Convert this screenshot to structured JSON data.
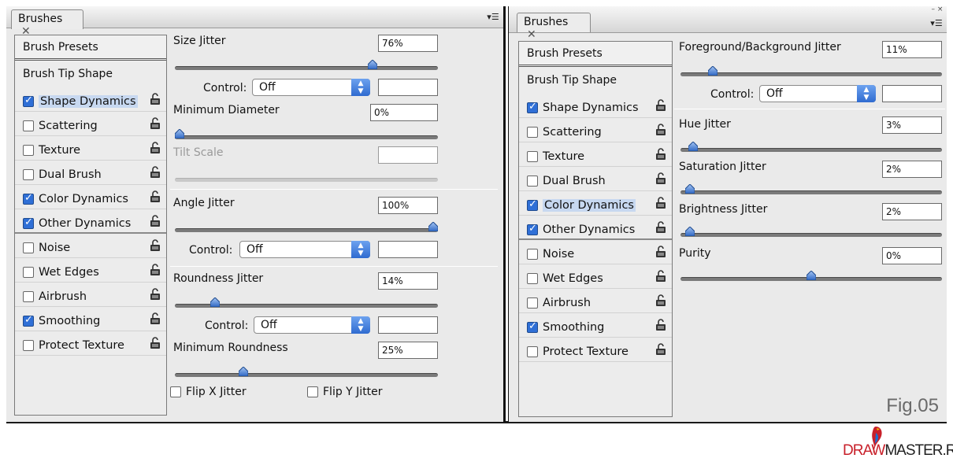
{
  "left_panel": {
    "tab_label": "Brushes",
    "sidebar": {
      "presets": "Brush Presets",
      "tip_shape": "Brush Tip Shape",
      "items": [
        {
          "label": "Shape Dynamics",
          "checked": true
        },
        {
          "label": "Scattering",
          "checked": false
        },
        {
          "label": "Texture",
          "checked": false
        },
        {
          "label": "Dual Brush",
          "checked": false
        },
        {
          "label": "Color Dynamics",
          "checked": true
        },
        {
          "label": "Other Dynamics",
          "checked": true
        },
        {
          "label": "Noise",
          "checked": false
        },
        {
          "label": "Wet Edges",
          "checked": false
        },
        {
          "label": "Airbrush",
          "checked": false
        },
        {
          "label": "Smoothing",
          "checked": true
        },
        {
          "label": "Protect Texture",
          "checked": false
        }
      ]
    },
    "size_jitter": {
      "label": "Size Jitter",
      "value": "76%",
      "level": 0.76
    },
    "control_1": {
      "label": "Control:",
      "value": "Off"
    },
    "min_diameter": {
      "label": "Minimum Diameter",
      "value": "0%",
      "level": 0.0
    },
    "tilt_scale": {
      "label": "Tilt Scale"
    },
    "angle_jitter": {
      "label": "Angle Jitter",
      "value": "100%",
      "level": 1.0
    },
    "control_2": {
      "label": "Control:",
      "value": "Off"
    },
    "roundness_jitter": {
      "label": "Roundness Jitter",
      "value": "14%",
      "level": 0.14
    },
    "control_3": {
      "label": "Control:",
      "value": "Off"
    },
    "min_roundness": {
      "label": "Minimum Roundness",
      "value": "25%",
      "level": 0.25
    },
    "flip_x": "Flip X Jitter",
    "flip_y": "Flip Y Jitter"
  },
  "right_panel": {
    "tab_label": "Brushes",
    "sidebar": {
      "presets": "Brush Presets",
      "tip_shape": "Brush Tip Shape",
      "items": [
        {
          "label": "Shape Dynamics",
          "checked": true
        },
        {
          "label": "Scattering",
          "checked": false
        },
        {
          "label": "Texture",
          "checked": false
        },
        {
          "label": "Dual Brush",
          "checked": false
        },
        {
          "label": "Color Dynamics",
          "checked": true
        },
        {
          "label": "Other Dynamics",
          "checked": true
        },
        {
          "label": "Noise",
          "checked": false
        },
        {
          "label": "Wet Edges",
          "checked": false
        },
        {
          "label": "Airbrush",
          "checked": false
        },
        {
          "label": "Smoothing",
          "checked": true
        },
        {
          "label": "Protect Texture",
          "checked": false
        }
      ]
    },
    "fg_bg_jitter": {
      "label": "Foreground/Background Jitter",
      "value": "11%",
      "level": 0.11
    },
    "control": {
      "label": "Control:",
      "value": "Off"
    },
    "hue_jitter": {
      "label": "Hue Jitter",
      "value": "3%",
      "level": 0.03
    },
    "saturation_jitter": {
      "label": "Saturation Jitter",
      "value": "2%",
      "level": 0.02
    },
    "brightness_jitter": {
      "label": "Brightness Jitter",
      "value": "2%",
      "level": 0.02
    },
    "purity": {
      "label": "Purity",
      "value": "0%",
      "level": 0.5
    },
    "fig_label": "Fig.05"
  },
  "watermark": {
    "part1": "DRAW",
    "part2": "MASTER.RU"
  },
  "colors": {
    "accent": "#2f6fd6",
    "panel_bg": "#eaeaea",
    "selection": "#c7d8f0"
  }
}
